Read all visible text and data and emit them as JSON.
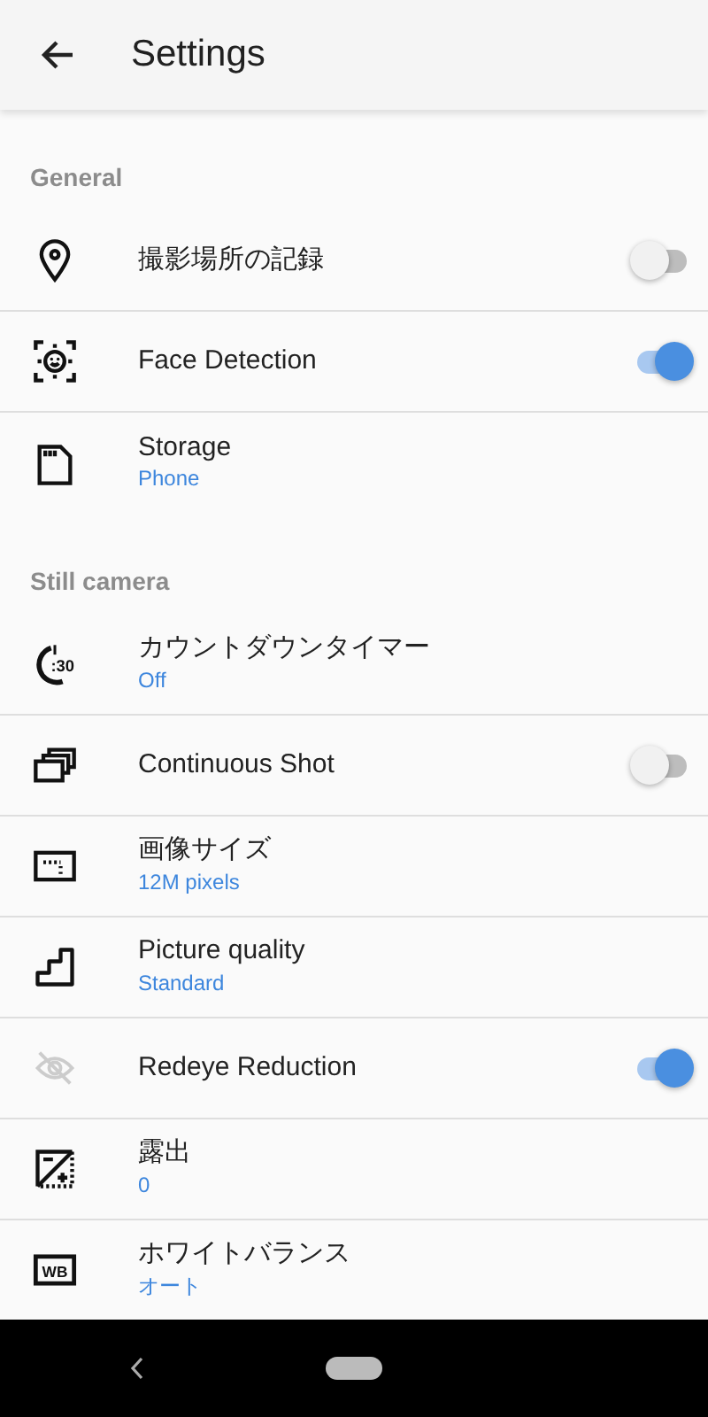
{
  "header": {
    "title": "Settings"
  },
  "sections": [
    {
      "title": "General",
      "items": [
        {
          "kind": "toggle",
          "title": "撮影場所の記録",
          "on": false
        },
        {
          "kind": "toggle",
          "title": "Face Detection",
          "on": true
        },
        {
          "kind": "value",
          "title": "Storage",
          "value": "Phone"
        }
      ]
    },
    {
      "title": "Still camera",
      "items": [
        {
          "kind": "value",
          "title": "カウントダウンタイマー",
          "value": "Off",
          "icon_text": ":30"
        },
        {
          "kind": "toggle",
          "title": "Continuous Shot",
          "on": false
        },
        {
          "kind": "value",
          "title": "画像サイズ",
          "value": "12M pixels"
        },
        {
          "kind": "value",
          "title": "Picture quality",
          "value": "Standard"
        },
        {
          "kind": "toggle",
          "title": "Redeye Reduction",
          "on": true
        },
        {
          "kind": "value",
          "title": "露出",
          "value": "0"
        },
        {
          "kind": "value",
          "title": "ホワイトバランス",
          "value": "オート",
          "icon_text": "WB"
        }
      ]
    }
  ]
}
